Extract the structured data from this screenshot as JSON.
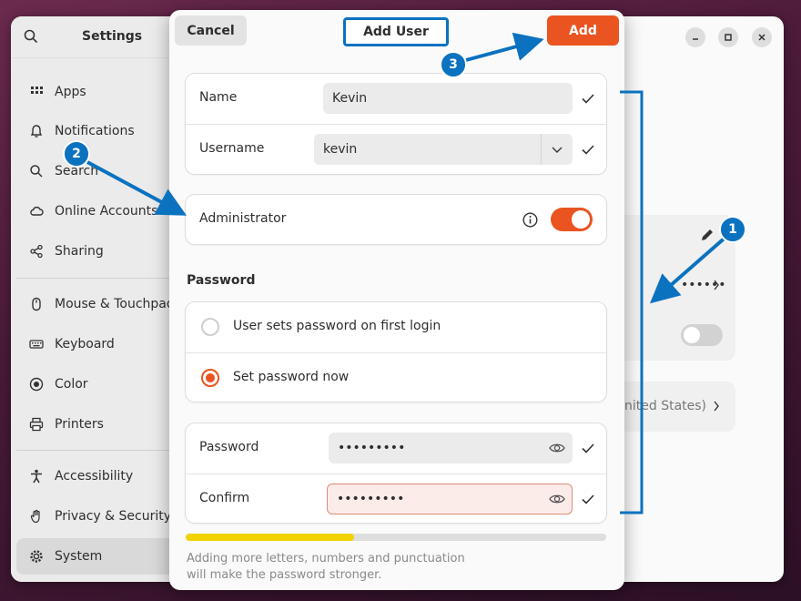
{
  "settings": {
    "title": "Settings",
    "sidebar_items": [
      {
        "label": "Apps",
        "icon": "apps-grid-icon"
      },
      {
        "label": "Notifications",
        "icon": "bell-icon"
      },
      {
        "label": "Search",
        "icon": "search-icon"
      },
      {
        "label": "Online Accounts",
        "icon": "cloud-icon"
      },
      {
        "label": "Sharing",
        "icon": "share-icon"
      },
      {
        "label": "Mouse & Touchpad",
        "icon": "mouse-icon"
      },
      {
        "label": "Keyboard",
        "icon": "keyboard-icon"
      },
      {
        "label": "Color",
        "icon": "color-icon"
      },
      {
        "label": "Printers",
        "icon": "printer-icon"
      },
      {
        "label": "Accessibility",
        "icon": "accessibility-icon"
      },
      {
        "label": "Privacy & Security",
        "icon": "hand-icon"
      },
      {
        "label": "System",
        "icon": "gear-icon"
      }
    ],
    "active_item": "System",
    "background_text": "nited States)",
    "password_dots": "••••••"
  },
  "dialog": {
    "cancel_label": "Cancel",
    "title": "Add User",
    "add_label": "Add",
    "name_label": "Name",
    "name_value": "Kevin",
    "username_label": "Username",
    "username_value": "kevin",
    "admin_label": "Administrator",
    "admin_enabled": true,
    "password_section": "Password",
    "radio_first_login": "User sets password on first login",
    "radio_set_now": "Set password now",
    "selected_radio": "Set password now",
    "password_label": "Password",
    "password_value": "•••••••••",
    "confirm_label": "Confirm",
    "confirm_value": "•••••••••",
    "strength_fraction": 0.4,
    "hint": "Adding more letters, numbers and punctuation will make the password stronger."
  },
  "annotations": {
    "badge_1": "1",
    "badge_2": "2",
    "badge_3": "3"
  },
  "colors": {
    "accent": "#e95420",
    "annotation": "#0b72c0",
    "strength": "#f0d300"
  }
}
